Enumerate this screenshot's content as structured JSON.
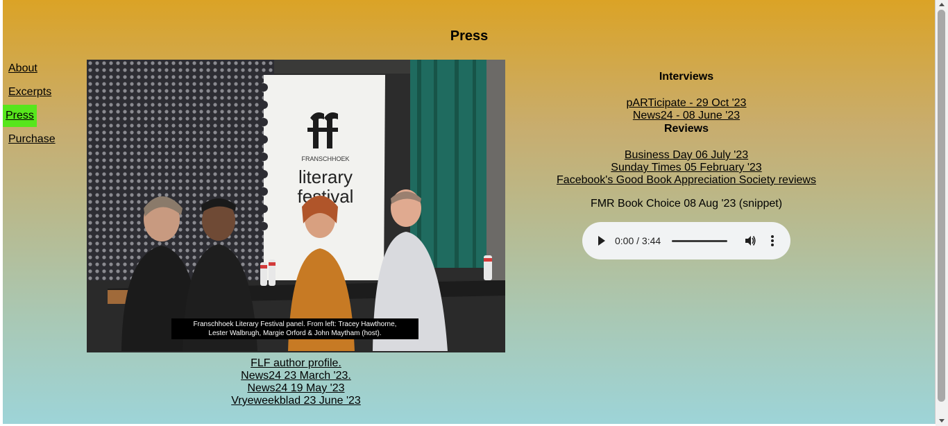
{
  "page": {
    "title": "Press"
  },
  "nav": {
    "items": [
      {
        "label": "About"
      },
      {
        "label": "Excerpts"
      },
      {
        "label": "Press",
        "active": true
      },
      {
        "label": "Purchase"
      }
    ],
    "active_color": "#57e61c"
  },
  "photo": {
    "caption_line1": "Franschhoek Literary Festival panel. From left: Tracey Hawthorne,",
    "caption_line2": "Lester Walbrugh, Margie Orford & John Maytham (host).",
    "banner_small": "FRANSCHHOEK",
    "banner_line1": "literary",
    "banner_line2": "festival"
  },
  "press_links": [
    "FLF author profile.",
    "News24 23 March '23.",
    "News24 19 May '23",
    "Vryeweekblad 23 June '23"
  ],
  "interviews": {
    "heading": "Interviews",
    "links": [
      "pARTicipate - 29 Oct '23",
      "News24 - 08 June '23"
    ]
  },
  "reviews": {
    "heading": "Reviews",
    "links": [
      "Business Day 06 July '23",
      "Sunday Times 05 February '23",
      "Facebook's Good Book Appreciation Society reviews"
    ]
  },
  "audio": {
    "label": "FMR Book Choice 08 Aug '23 (snippet)",
    "time": "0:00 / 3:44",
    "icons": [
      "play-icon",
      "volume-icon",
      "more-vert-icon"
    ]
  },
  "colors": {
    "gradient_top": "#dba326",
    "gradient_bottom": "#9dd4d8"
  }
}
